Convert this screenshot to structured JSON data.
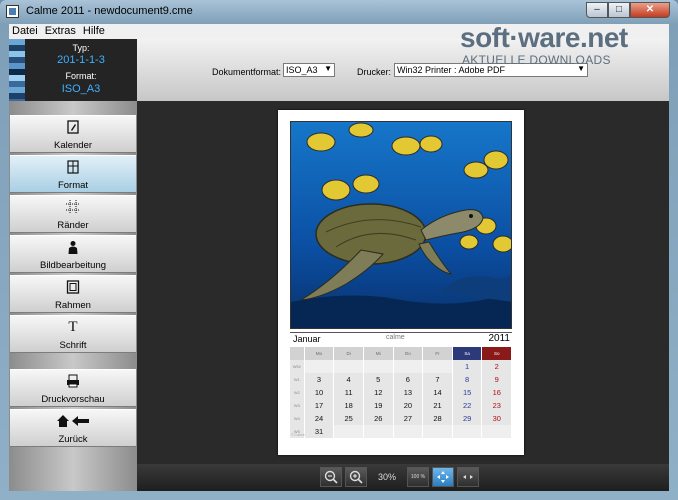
{
  "window": {
    "title": "Calme 2011 - newdocument9.cme"
  },
  "menu": [
    "Datei",
    "Extras",
    "Hilfe"
  ],
  "watermark": {
    "main": "soft·ware.net",
    "sub": "AKTUELLE DOWNLOADS"
  },
  "info": {
    "typ_label": "Typ:",
    "typ_value": "201-1-1-3",
    "format_label": "Format:",
    "format_value": "ISO_A3"
  },
  "toolbar": {
    "dokumentformat_label": "Dokumentformat:",
    "dokumentformat_value": "ISO_A3",
    "drucker_label": "Drucker:",
    "drucker_value": "Win32 Printer : Adobe PDF"
  },
  "nav": [
    {
      "label": "Kalender",
      "icon": "calendar-edit-icon"
    },
    {
      "label": "Format",
      "icon": "format-icon",
      "active": true
    },
    {
      "label": "Ränder",
      "icon": "margins-icon"
    },
    {
      "label": "Bildbearbeitung",
      "icon": "person-icon"
    },
    {
      "label": "Rahmen",
      "icon": "frame-icon"
    },
    {
      "label": "Schrift",
      "icon": "font-icon"
    },
    {
      "label": "Druckvorschau",
      "icon": "print-preview-icon"
    },
    {
      "label": "Zurück",
      "icon": "home-back-icon"
    }
  ],
  "calendar": {
    "month": "Januar",
    "brand": "calme",
    "year": "2011",
    "weekdays": [
      "Mo",
      "Di",
      "Mi",
      "Do",
      "Fr",
      "Sa",
      "So"
    ],
    "weeks": [
      {
        "wk": "W52",
        "days": [
          "",
          "",
          "",
          "",
          "",
          "1",
          "2"
        ]
      },
      {
        "wk": "W1",
        "days": [
          "3",
          "4",
          "5",
          "6",
          "7",
          "8",
          "9"
        ]
      },
      {
        "wk": "W2",
        "days": [
          "10",
          "11",
          "12",
          "13",
          "14",
          "15",
          "16"
        ]
      },
      {
        "wk": "W3",
        "days": [
          "17",
          "18",
          "19",
          "20",
          "21",
          "22",
          "23"
        ]
      },
      {
        "wk": "W4",
        "days": [
          "24",
          "25",
          "26",
          "27",
          "28",
          "29",
          "30"
        ]
      },
      {
        "wk": "W5",
        "days": [
          "31",
          "",
          "",
          "",
          "",
          "",
          ""
        ]
      }
    ],
    "footnote": "© Calme"
  },
  "status": {
    "zoom": "30%",
    "fit_label": "100 %"
  },
  "colors": {
    "accent_blue": "#3fb0ff",
    "active_nav": "#a9cfe4",
    "saturday": "#2c3a7a",
    "sunday": "#8a1a1a"
  }
}
